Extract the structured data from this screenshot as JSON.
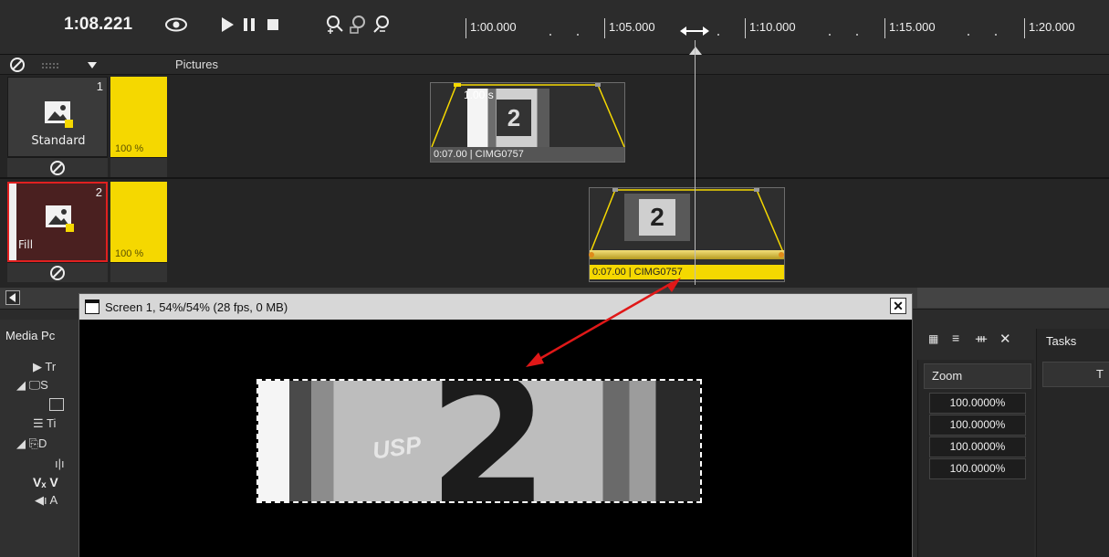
{
  "toolbar": {
    "time": "1:08.221",
    "icons": [
      "eye-icon",
      "play-icon",
      "pause-icon",
      "stop-icon",
      "zoom-in-icon",
      "zoom-fit-icon",
      "zoom-out-icon"
    ],
    "ruler_labels": [
      "1:00.000",
      "1:05.000",
      "1:10.000",
      "1:15.000",
      "1:20.000"
    ]
  },
  "track_header": {
    "group_label": "Pictures"
  },
  "tracks": [
    {
      "number": "1",
      "mode": "Standard",
      "volume": "100 %",
      "clip": {
        "duration_badge": "1.00 s",
        "label": "0:07.00 | CIMG0757"
      }
    },
    {
      "number": "2",
      "mode": "Fill",
      "volume": "100 %",
      "clip": {
        "label": "0:07.00 | CIMG0757"
      }
    }
  ],
  "preview": {
    "title": "Screen 1, 54%/54% (28 fps, 0 MB)",
    "image_text": "USP"
  },
  "media_pool": {
    "title": "Media Pc",
    "items": [
      "Tr",
      "S",
      "",
      "Ti",
      "D",
      "",
      "V",
      "A"
    ]
  },
  "zoom_panel": {
    "header": "Zoom",
    "values": [
      "100.0000%",
      "100.0000%",
      "100.0000%",
      "100.0000%"
    ]
  },
  "tasks_panel": {
    "title": "Tasks",
    "column": "T"
  },
  "colors": {
    "accent_yellow": "#f5d800",
    "selection_red": "#e02020",
    "arrow_red": "#e01818"
  }
}
